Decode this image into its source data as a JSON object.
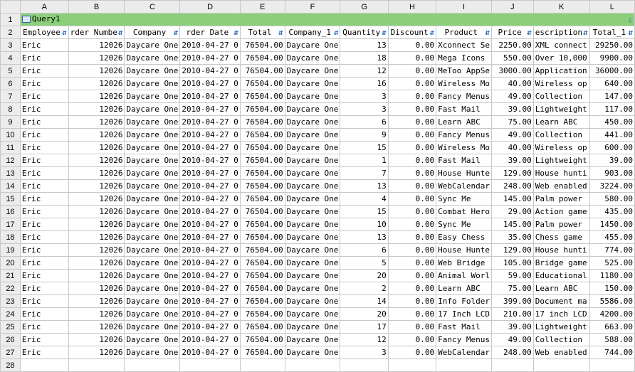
{
  "columns": [
    "A",
    "B",
    "C",
    "D",
    "E",
    "F",
    "G",
    "H",
    "I",
    "J",
    "K",
    "L"
  ],
  "query_title": "Query1",
  "fields": [
    "Employee",
    "rder Numbe",
    "Company",
    "rder Date",
    "Total",
    "Company_1",
    "Quantity",
    "Discount",
    "Product",
    "Price",
    "escription",
    "Total_1"
  ],
  "rows": [
    {
      "n": "3",
      "employee": "Eric",
      "order": "12026",
      "company": "Daycare One",
      "date": "2010-04-27 0",
      "total": "76504.00",
      "company1": "Daycare One",
      "qty": "13",
      "discount": "0.00",
      "product": "Xconnect Se",
      "price": "2250.00",
      "desc": "XML connect",
      "total1": "29250.00"
    },
    {
      "n": "4",
      "employee": "Eric",
      "order": "12026",
      "company": "Daycare One",
      "date": "2010-04-27 0",
      "total": "76504.00",
      "company1": "Daycare One",
      "qty": "18",
      "discount": "0.00",
      "product": "Mega Icons",
      "price": "550.00",
      "desc": "Over 10,000",
      "total1": "9900.00"
    },
    {
      "n": "5",
      "employee": "Eric",
      "order": "12026",
      "company": "Daycare One",
      "date": "2010-04-27 0",
      "total": "76504.00",
      "company1": "Daycare One",
      "qty": "12",
      "discount": "0.00",
      "product": "MeToo AppSe",
      "price": "3000.00",
      "desc": "Application",
      "total1": "36000.00"
    },
    {
      "n": "6",
      "employee": "Eric",
      "order": "12026",
      "company": "Daycare One",
      "date": "2010-04-27 0",
      "total": "76504.00",
      "company1": "Daycare One",
      "qty": "16",
      "discount": "0.00",
      "product": "Wireless Mo",
      "price": "40.00",
      "desc": "Wireless op",
      "total1": "640.00"
    },
    {
      "n": "7",
      "employee": "Eric",
      "order": "12026",
      "company": "Daycare One",
      "date": "2010-04-27 0",
      "total": "76504.00",
      "company1": "Daycare One",
      "qty": "3",
      "discount": "0.00",
      "product": "Fancy Menus",
      "price": "49.00",
      "desc": "Collection",
      "total1": "147.00"
    },
    {
      "n": "8",
      "employee": "Eric",
      "order": "12026",
      "company": "Daycare One",
      "date": "2010-04-27 0",
      "total": "76504.00",
      "company1": "Daycare One",
      "qty": "3",
      "discount": "0.00",
      "product": "Fast Mail",
      "price": "39.00",
      "desc": "Lightweight",
      "total1": "117.00"
    },
    {
      "n": "9",
      "employee": "Eric",
      "order": "12026",
      "company": "Daycare One",
      "date": "2010-04-27 0",
      "total": "76504.00",
      "company1": "Daycare One",
      "qty": "6",
      "discount": "0.00",
      "product": "Learn ABC",
      "price": "75.00",
      "desc": "Learn ABC",
      "total1": "450.00"
    },
    {
      "n": "10",
      "employee": "Eric",
      "order": "12026",
      "company": "Daycare One",
      "date": "2010-04-27 0",
      "total": "76504.00",
      "company1": "Daycare One",
      "qty": "9",
      "discount": "0.00",
      "product": "Fancy Menus",
      "price": "49.00",
      "desc": "Collection",
      "total1": "441.00"
    },
    {
      "n": "11",
      "employee": "Eric",
      "order": "12026",
      "company": "Daycare One",
      "date": "2010-04-27 0",
      "total": "76504.00",
      "company1": "Daycare One",
      "qty": "15",
      "discount": "0.00",
      "product": "Wireless Mo",
      "price": "40.00",
      "desc": "Wireless op",
      "total1": "600.00"
    },
    {
      "n": "12",
      "employee": "Eric",
      "order": "12026",
      "company": "Daycare One",
      "date": "2010-04-27 0",
      "total": "76504.00",
      "company1": "Daycare One",
      "qty": "1",
      "discount": "0.00",
      "product": "Fast Mail",
      "price": "39.00",
      "desc": "Lightweight",
      "total1": "39.00"
    },
    {
      "n": "13",
      "employee": "Eric",
      "order": "12026",
      "company": "Daycare One",
      "date": "2010-04-27 0",
      "total": "76504.00",
      "company1": "Daycare One",
      "qty": "7",
      "discount": "0.00",
      "product": "House Hunte",
      "price": "129.00",
      "desc": "House hunti",
      "total1": "903.00"
    },
    {
      "n": "14",
      "employee": "Eric",
      "order": "12026",
      "company": "Daycare One",
      "date": "2010-04-27 0",
      "total": "76504.00",
      "company1": "Daycare One",
      "qty": "13",
      "discount": "0.00",
      "product": "WebCalendar",
      "price": "248.00",
      "desc": "Web enabled",
      "total1": "3224.00"
    },
    {
      "n": "15",
      "employee": "Eric",
      "order": "12026",
      "company": "Daycare One",
      "date": "2010-04-27 0",
      "total": "76504.00",
      "company1": "Daycare One",
      "qty": "4",
      "discount": "0.00",
      "product": "Sync Me",
      "price": "145.00",
      "desc": "Palm power",
      "total1": "580.00"
    },
    {
      "n": "16",
      "employee": "Eric",
      "order": "12026",
      "company": "Daycare One",
      "date": "2010-04-27 0",
      "total": "76504.00",
      "company1": "Daycare One",
      "qty": "15",
      "discount": "0.00",
      "product": "Combat Hero",
      "price": "29.00",
      "desc": "Action game",
      "total1": "435.00"
    },
    {
      "n": "17",
      "employee": "Eric",
      "order": "12026",
      "company": "Daycare One",
      "date": "2010-04-27 0",
      "total": "76504.00",
      "company1": "Daycare One",
      "qty": "10",
      "discount": "0.00",
      "product": "Sync Me",
      "price": "145.00",
      "desc": "Palm power",
      "total1": "1450.00"
    },
    {
      "n": "18",
      "employee": "Eric",
      "order": "12026",
      "company": "Daycare One",
      "date": "2010-04-27 0",
      "total": "76504.00",
      "company1": "Daycare One",
      "qty": "13",
      "discount": "0.00",
      "product": "Easy Chess",
      "price": "35.00",
      "desc": "Chess game",
      "total1": "455.00"
    },
    {
      "n": "19",
      "employee": "Eric",
      "order": "12026",
      "company": "Daycare One",
      "date": "2010-04-27 0",
      "total": "76504.00",
      "company1": "Daycare One",
      "qty": "6",
      "discount": "0.00",
      "product": "House Hunte",
      "price": "129.00",
      "desc": "House hunti",
      "total1": "774.00"
    },
    {
      "n": "20",
      "employee": "Eric",
      "order": "12026",
      "company": "Daycare One",
      "date": "2010-04-27 0",
      "total": "76504.00",
      "company1": "Daycare One",
      "qty": "5",
      "discount": "0.00",
      "product": "Web Bridge",
      "price": "105.00",
      "desc": "Bridge game",
      "total1": "525.00"
    },
    {
      "n": "21",
      "employee": "Eric",
      "order": "12026",
      "company": "Daycare One",
      "date": "2010-04-27 0",
      "total": "76504.00",
      "company1": "Daycare One",
      "qty": "20",
      "discount": "0.00",
      "product": "Animal Worl",
      "price": "59.00",
      "desc": "Educational",
      "total1": "1180.00"
    },
    {
      "n": "22",
      "employee": "Eric",
      "order": "12026",
      "company": "Daycare One",
      "date": "2010-04-27 0",
      "total": "76504.00",
      "company1": "Daycare One",
      "qty": "2",
      "discount": "0.00",
      "product": "Learn ABC",
      "price": "75.00",
      "desc": "Learn ABC",
      "total1": "150.00"
    },
    {
      "n": "23",
      "employee": "Eric",
      "order": "12026",
      "company": "Daycare One",
      "date": "2010-04-27 0",
      "total": "76504.00",
      "company1": "Daycare One",
      "qty": "14",
      "discount": "0.00",
      "product": "Info Folder",
      "price": "399.00",
      "desc": "Document ma",
      "total1": "5586.00"
    },
    {
      "n": "24",
      "employee": "Eric",
      "order": "12026",
      "company": "Daycare One",
      "date": "2010-04-27 0",
      "total": "76504.00",
      "company1": "Daycare One",
      "qty": "20",
      "discount": "0.00",
      "product": "17 Inch LCD",
      "price": "210.00",
      "desc": "17 inch LCD",
      "total1": "4200.00"
    },
    {
      "n": "25",
      "employee": "Eric",
      "order": "12026",
      "company": "Daycare One",
      "date": "2010-04-27 0",
      "total": "76504.00",
      "company1": "Daycare One",
      "qty": "17",
      "discount": "0.00",
      "product": "Fast Mail",
      "price": "39.00",
      "desc": "Lightweight",
      "total1": "663.00"
    },
    {
      "n": "26",
      "employee": "Eric",
      "order": "12026",
      "company": "Daycare One",
      "date": "2010-04-27 0",
      "total": "76504.00",
      "company1": "Daycare One",
      "qty": "12",
      "discount": "0.00",
      "product": "Fancy Menus",
      "price": "49.00",
      "desc": "Collection",
      "total1": "588.00"
    },
    {
      "n": "27",
      "employee": "Eric",
      "order": "12026",
      "company": "Daycare One",
      "date": "2010-04-27 0",
      "total": "76504.00",
      "company1": "Daycare One",
      "qty": "3",
      "discount": "0.00",
      "product": "WebCalendar",
      "price": "248.00",
      "desc": "Web enabled",
      "total1": "744.00"
    }
  ],
  "last_row_number": "28",
  "colors": {
    "title_bar": "#8ccf7a",
    "header_bg": "#ececec",
    "grid": "#c8c8c8",
    "arrow": "#2e6fbf"
  }
}
